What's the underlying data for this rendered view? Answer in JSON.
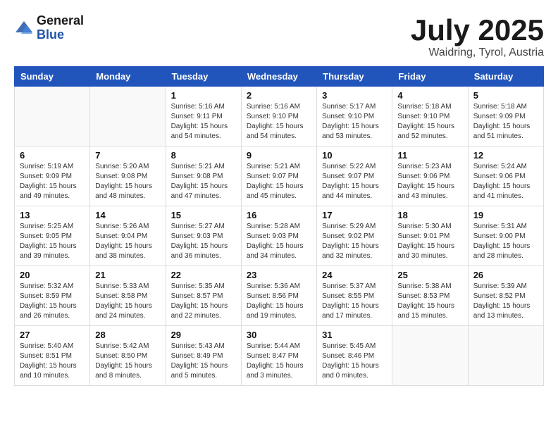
{
  "logo": {
    "general": "General",
    "blue": "Blue"
  },
  "header": {
    "month": "July 2025",
    "location": "Waidring, Tyrol, Austria"
  },
  "weekdays": [
    "Sunday",
    "Monday",
    "Tuesday",
    "Wednesday",
    "Thursday",
    "Friday",
    "Saturday"
  ],
  "weeks": [
    [
      {
        "day": "",
        "info": ""
      },
      {
        "day": "",
        "info": ""
      },
      {
        "day": "1",
        "info": "Sunrise: 5:16 AM\nSunset: 9:11 PM\nDaylight: 15 hours and 54 minutes."
      },
      {
        "day": "2",
        "info": "Sunrise: 5:16 AM\nSunset: 9:10 PM\nDaylight: 15 hours and 54 minutes."
      },
      {
        "day": "3",
        "info": "Sunrise: 5:17 AM\nSunset: 9:10 PM\nDaylight: 15 hours and 53 minutes."
      },
      {
        "day": "4",
        "info": "Sunrise: 5:18 AM\nSunset: 9:10 PM\nDaylight: 15 hours and 52 minutes."
      },
      {
        "day": "5",
        "info": "Sunrise: 5:18 AM\nSunset: 9:09 PM\nDaylight: 15 hours and 51 minutes."
      }
    ],
    [
      {
        "day": "6",
        "info": "Sunrise: 5:19 AM\nSunset: 9:09 PM\nDaylight: 15 hours and 49 minutes."
      },
      {
        "day": "7",
        "info": "Sunrise: 5:20 AM\nSunset: 9:08 PM\nDaylight: 15 hours and 48 minutes."
      },
      {
        "day": "8",
        "info": "Sunrise: 5:21 AM\nSunset: 9:08 PM\nDaylight: 15 hours and 47 minutes."
      },
      {
        "day": "9",
        "info": "Sunrise: 5:21 AM\nSunset: 9:07 PM\nDaylight: 15 hours and 45 minutes."
      },
      {
        "day": "10",
        "info": "Sunrise: 5:22 AM\nSunset: 9:07 PM\nDaylight: 15 hours and 44 minutes."
      },
      {
        "day": "11",
        "info": "Sunrise: 5:23 AM\nSunset: 9:06 PM\nDaylight: 15 hours and 43 minutes."
      },
      {
        "day": "12",
        "info": "Sunrise: 5:24 AM\nSunset: 9:06 PM\nDaylight: 15 hours and 41 minutes."
      }
    ],
    [
      {
        "day": "13",
        "info": "Sunrise: 5:25 AM\nSunset: 9:05 PM\nDaylight: 15 hours and 39 minutes."
      },
      {
        "day": "14",
        "info": "Sunrise: 5:26 AM\nSunset: 9:04 PM\nDaylight: 15 hours and 38 minutes."
      },
      {
        "day": "15",
        "info": "Sunrise: 5:27 AM\nSunset: 9:03 PM\nDaylight: 15 hours and 36 minutes."
      },
      {
        "day": "16",
        "info": "Sunrise: 5:28 AM\nSunset: 9:03 PM\nDaylight: 15 hours and 34 minutes."
      },
      {
        "day": "17",
        "info": "Sunrise: 5:29 AM\nSunset: 9:02 PM\nDaylight: 15 hours and 32 minutes."
      },
      {
        "day": "18",
        "info": "Sunrise: 5:30 AM\nSunset: 9:01 PM\nDaylight: 15 hours and 30 minutes."
      },
      {
        "day": "19",
        "info": "Sunrise: 5:31 AM\nSunset: 9:00 PM\nDaylight: 15 hours and 28 minutes."
      }
    ],
    [
      {
        "day": "20",
        "info": "Sunrise: 5:32 AM\nSunset: 8:59 PM\nDaylight: 15 hours and 26 minutes."
      },
      {
        "day": "21",
        "info": "Sunrise: 5:33 AM\nSunset: 8:58 PM\nDaylight: 15 hours and 24 minutes."
      },
      {
        "day": "22",
        "info": "Sunrise: 5:35 AM\nSunset: 8:57 PM\nDaylight: 15 hours and 22 minutes."
      },
      {
        "day": "23",
        "info": "Sunrise: 5:36 AM\nSunset: 8:56 PM\nDaylight: 15 hours and 19 minutes."
      },
      {
        "day": "24",
        "info": "Sunrise: 5:37 AM\nSunset: 8:55 PM\nDaylight: 15 hours and 17 minutes."
      },
      {
        "day": "25",
        "info": "Sunrise: 5:38 AM\nSunset: 8:53 PM\nDaylight: 15 hours and 15 minutes."
      },
      {
        "day": "26",
        "info": "Sunrise: 5:39 AM\nSunset: 8:52 PM\nDaylight: 15 hours and 13 minutes."
      }
    ],
    [
      {
        "day": "27",
        "info": "Sunrise: 5:40 AM\nSunset: 8:51 PM\nDaylight: 15 hours and 10 minutes."
      },
      {
        "day": "28",
        "info": "Sunrise: 5:42 AM\nSunset: 8:50 PM\nDaylight: 15 hours and 8 minutes."
      },
      {
        "day": "29",
        "info": "Sunrise: 5:43 AM\nSunset: 8:49 PM\nDaylight: 15 hours and 5 minutes."
      },
      {
        "day": "30",
        "info": "Sunrise: 5:44 AM\nSunset: 8:47 PM\nDaylight: 15 hours and 3 minutes."
      },
      {
        "day": "31",
        "info": "Sunrise: 5:45 AM\nSunset: 8:46 PM\nDaylight: 15 hours and 0 minutes."
      },
      {
        "day": "",
        "info": ""
      },
      {
        "day": "",
        "info": ""
      }
    ]
  ]
}
